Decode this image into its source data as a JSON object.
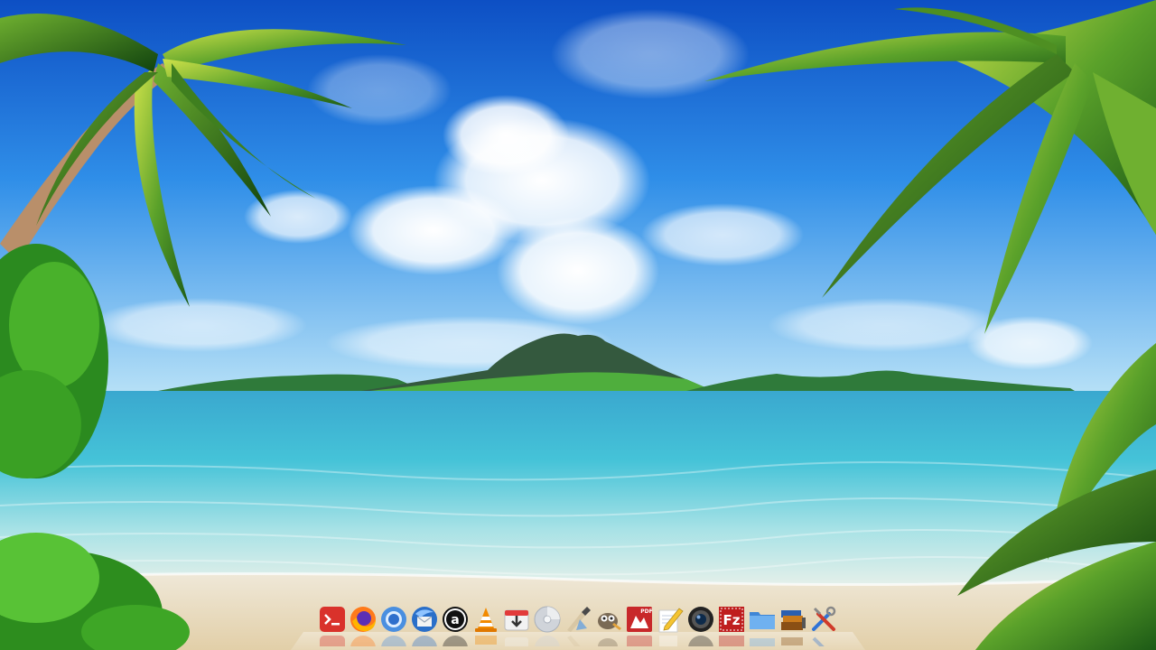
{
  "desktop": {
    "wallpaper": "tropical-beach-wallpaper"
  },
  "dock": {
    "items": [
      {
        "id": "terminal",
        "icon": "terminal-icon",
        "color": "#d9322b"
      },
      {
        "id": "firefox",
        "icon": "firefox-icon",
        "color": "#ff7a1a"
      },
      {
        "id": "chromium",
        "icon": "chromium-icon",
        "color": "#4a8fe0"
      },
      {
        "id": "thunderbird",
        "icon": "thunderbird-icon",
        "color": "#2a6fc9"
      },
      {
        "id": "amazon",
        "icon": "amazon-icon",
        "color": "#111111"
      },
      {
        "id": "vlc",
        "icon": "vlc-cone-icon",
        "color": "#f28a00"
      },
      {
        "id": "downloader",
        "icon": "download-icon",
        "color": "#e23a3a"
      },
      {
        "id": "disc-burner",
        "icon": "disc-icon",
        "color": "#d0d4da"
      },
      {
        "id": "inkscape",
        "icon": "inkscape-icon",
        "color": "#4a4a4a"
      },
      {
        "id": "gimp",
        "icon": "gimp-icon",
        "color": "#7a6a55"
      },
      {
        "id": "pdf-reader",
        "icon": "pdf-icon",
        "color": "#c8282a",
        "label": "PDF"
      },
      {
        "id": "text-editor",
        "icon": "pencil-notepad-icon",
        "color": "#f5c431"
      },
      {
        "id": "webcam",
        "icon": "camera-icon",
        "color": "#222222"
      },
      {
        "id": "filezilla",
        "icon": "filezilla-icon",
        "color": "#bf1e1e",
        "label": "Fz"
      },
      {
        "id": "file-manager",
        "icon": "folder-icon",
        "color": "#5aa0e6"
      },
      {
        "id": "archive-manager",
        "icon": "archive-icon",
        "color": "#c97a1c"
      },
      {
        "id": "settings",
        "icon": "tools-icon",
        "color": "#2f73d6"
      }
    ]
  }
}
